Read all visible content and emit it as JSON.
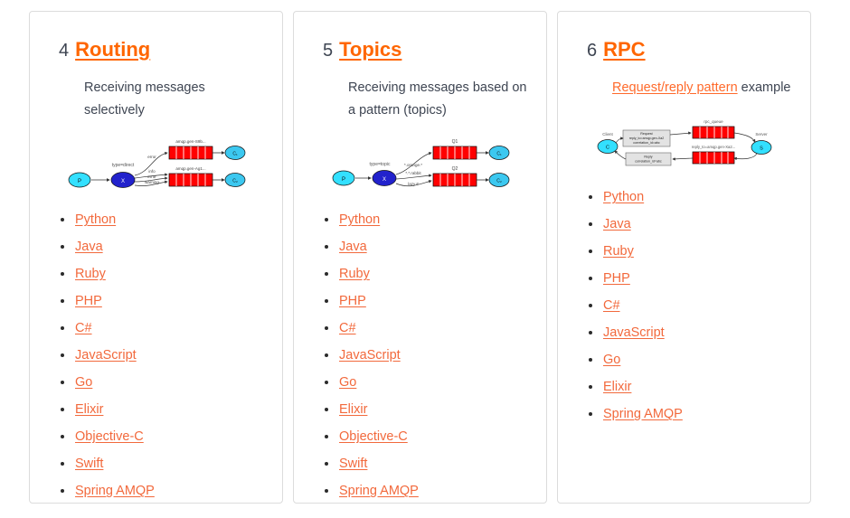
{
  "cards": [
    {
      "number": "4",
      "title": "Routing",
      "description_prefix": "Receiving messages selectively",
      "description_link": "",
      "description_suffix": "",
      "diagram": {
        "name": "direct-exchange-routing-diagram",
        "producer": "P",
        "exchange": "X",
        "exchange_label": "type=direct",
        "binding_keys": [
          "error",
          "info",
          "error",
          "warning"
        ],
        "queues": [
          {
            "label": "amqp.gen-S9b...",
            "consumer": "C₁"
          },
          {
            "label": "amqp.gen-Ag1...",
            "consumer": "C₂"
          }
        ]
      },
      "languages": [
        "Python",
        "Java",
        "Ruby",
        "PHP",
        "C#",
        "JavaScript",
        "Go",
        "Elixir",
        "Objective-C",
        "Swift",
        "Spring AMQP"
      ]
    },
    {
      "number": "5",
      "title": "Topics",
      "description_prefix": "Receiving messages based on a pattern (topics)",
      "description_link": "",
      "description_suffix": "",
      "diagram": {
        "name": "topic-exchange-routing-diagram",
        "producer": "P",
        "exchange": "X",
        "exchange_label": "type=topic",
        "binding_keys": [
          "*.orange.*",
          "*.*.rabbit",
          "lazy.#"
        ],
        "queues": [
          {
            "label": "Q1",
            "consumer": "C₁"
          },
          {
            "label": "Q2",
            "consumer": "C₂"
          }
        ]
      },
      "languages": [
        "Python",
        "Java",
        "Ruby",
        "PHP",
        "C#",
        "JavaScript",
        "Go",
        "Elixir",
        "Objective-C",
        "Swift",
        "Spring AMQP"
      ]
    },
    {
      "number": "6",
      "title": "RPC",
      "description_prefix": "",
      "description_link": "Request/reply pattern",
      "description_suffix": "example",
      "diagram": {
        "name": "rpc-request-reply-diagram",
        "client": "C",
        "client_label": "Client",
        "server": "S",
        "server_label": "Server",
        "request_box": [
          "Request",
          "reply_to=amqp.gen-Xa2",
          "correlation_id=abc"
        ],
        "reply_box": [
          "Reply",
          "correlation_id=abc"
        ],
        "queues": [
          {
            "label": "rpc_queue"
          },
          {
            "label": "reply_to=amqp.gen-Xa2..."
          }
        ]
      },
      "languages": [
        "Python",
        "Java",
        "Ruby",
        "PHP",
        "C#",
        "JavaScript",
        "Go",
        "Elixir",
        "Spring AMQP"
      ]
    }
  ],
  "colors": {
    "accent": "#ff6600",
    "link": "#f2693c",
    "text": "#3e4552",
    "border": "#dcdcdc",
    "queue_red": "#ff0000",
    "producer_cyan": "#33e0ff",
    "exchange_blue": "#2222cc",
    "consumer_blue": "#3cc8f0"
  }
}
